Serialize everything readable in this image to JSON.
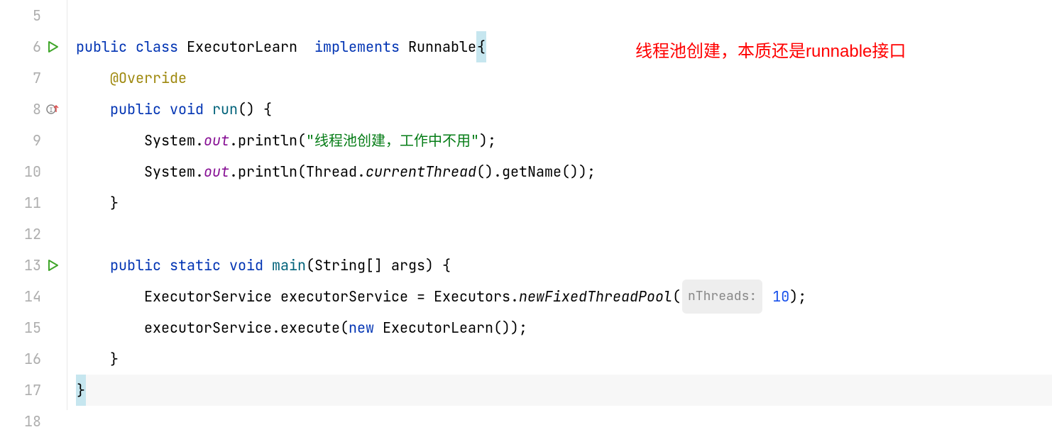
{
  "gutter": {
    "lines": [
      "5",
      "6",
      "7",
      "8",
      "9",
      "10",
      "11",
      "12",
      "13",
      "14",
      "15",
      "16",
      "17",
      "18"
    ]
  },
  "code": {
    "l6": {
      "kw_public": "public",
      "kw_class": "class",
      "cls_name": "ExecutorLearn",
      "kw_implements": "implements",
      "iface": "Runnable",
      "brace": "{"
    },
    "l7": {
      "ann": "@Override"
    },
    "l8": {
      "kw_public": "public",
      "kw_void": "void",
      "mtd": "run",
      "params": "()",
      "brace": " {"
    },
    "l9": {
      "cls": "System",
      "dot1": ".",
      "field": "out",
      "dot2": ".",
      "mtd": "println",
      "open": "(",
      "str": "\"线程池创建，工作中不用\"",
      "close": ");"
    },
    "l10": {
      "cls": "System",
      "dot1": ".",
      "field": "out",
      "dot2": ".",
      "mtd": "println",
      "open": "(",
      "cls2": "Thread",
      "dot3": ".",
      "smtd": "currentThread",
      "call1": "().",
      "mtd2": "getName",
      "call2": "());"
    },
    "l11": {
      "brace": "}"
    },
    "l13": {
      "kw_public": "public",
      "kw_static": "static",
      "kw_void": "void",
      "mtd": "main",
      "open": "(",
      "cls": "String",
      "arr": "[] ",
      "arg": "args",
      "close": ") {"
    },
    "l14": {
      "cls1": "ExecutorService",
      "var": " executorService ",
      "eq": "= ",
      "cls2": "Executors",
      "dot": ".",
      "smtd": "newFixedThreadPool",
      "open": "(",
      "hint": "nThreads:",
      "num": " 10",
      "close": ");"
    },
    "l15": {
      "var": "executorService",
      "dot": ".",
      "mtd": "execute",
      "open": "(",
      "kw_new": "new",
      "sp": " ",
      "cls": "ExecutorLearn",
      "call": "());"
    },
    "l16": {
      "brace": "}"
    },
    "l17": {
      "brace": "}"
    }
  },
  "annotation": "线程池创建，本质还是runnable接口"
}
